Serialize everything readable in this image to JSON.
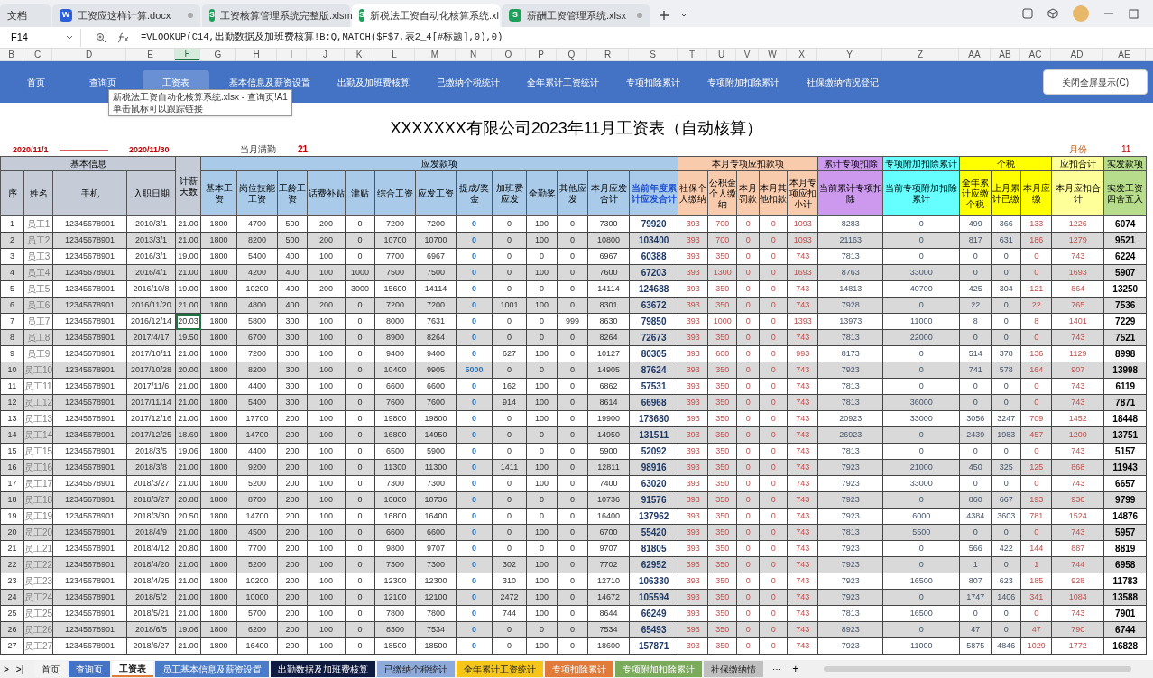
{
  "app_tabs": [
    {
      "kind": "plain",
      "label": "文档",
      "selected": false
    },
    {
      "kind": "doc",
      "icon_letter": "W",
      "label": "工资应这样计算.docx",
      "selected": false
    },
    {
      "kind": "sheet",
      "icon_letter": "S",
      "label": "工资核算管理系统完整版.xlsm",
      "selected": false
    },
    {
      "kind": "sheet",
      "icon_letter": "S",
      "label": "新税法工资自动化核算系统.xl",
      "selected": true
    },
    {
      "kind": "sheet",
      "icon_letter": "S",
      "label": "薪酬工资管理系统.xlsx",
      "selected": false
    }
  ],
  "formula_bar": {
    "cell_ref": "F14",
    "formula": "=VLOOKUP(C14,出勤数据及加班费核算!B:Q,MATCH($F$7,表2_4[#标题],0),0)"
  },
  "column_letters": [
    {
      "label": "B",
      "selected": false
    },
    {
      "label": "C",
      "selected": false
    },
    {
      "label": "D",
      "selected": false
    },
    {
      "label": "E",
      "selected": false
    },
    {
      "label": "F",
      "selected": true
    },
    {
      "label": "G",
      "selected": false
    },
    {
      "label": "H",
      "selected": false
    },
    {
      "label": "I",
      "selected": false
    },
    {
      "label": "J",
      "selected": false
    },
    {
      "label": "K",
      "selected": false
    },
    {
      "label": "L",
      "selected": false
    },
    {
      "label": "M",
      "selected": false
    },
    {
      "label": "N",
      "selected": false
    },
    {
      "label": "O",
      "selected": false
    },
    {
      "label": "P",
      "selected": false
    },
    {
      "label": "Q",
      "selected": false
    },
    {
      "label": "R",
      "selected": false
    },
    {
      "label": "S",
      "selected": false
    },
    {
      "label": "T",
      "selected": false
    },
    {
      "label": "U",
      "selected": false
    },
    {
      "label": "V",
      "selected": false
    },
    {
      "label": "W",
      "selected": false
    },
    {
      "label": "X",
      "selected": false
    },
    {
      "label": "Y",
      "selected": false
    },
    {
      "label": "Z",
      "selected": false
    },
    {
      "label": "AA",
      "selected": false
    },
    {
      "label": "AB",
      "selected": false
    },
    {
      "label": "AC",
      "selected": false
    },
    {
      "label": "AD",
      "selected": false
    },
    {
      "label": "AE",
      "selected": false
    }
  ],
  "nav": {
    "items": [
      {
        "label": "首页",
        "selected": false
      },
      {
        "label": "查询页",
        "selected": false
      },
      {
        "label": "工资表",
        "selected": true
      },
      {
        "label": "基本信息及薪资设置",
        "selected": false
      },
      {
        "label": "出勤及加班费核算",
        "selected": false
      },
      {
        "label": "已缴纳个税统计",
        "selected": false
      },
      {
        "label": "全年累计工资统计",
        "selected": false
      },
      {
        "label": "专项扣除累计",
        "selected": false
      },
      {
        "label": "专项附加扣除累计",
        "selected": false
      },
      {
        "label": "社保缴纳情况登记",
        "selected": false
      }
    ],
    "close_button": "关闭全屏显示(C)"
  },
  "tooltip": {
    "line_1": "新税法工资自动化核算系统.xlsx - 查询页!A1",
    "line_2": "单击鼠标可以跟踪链接"
  },
  "title": "XXXXXXX有限公司2023年11月工资表（自动核算）",
  "period": {
    "start": "2020/11/1",
    "separator": "——————",
    "end": "2020/11/30",
    "full_attendance_label": "当月满勤",
    "full_attendance_days": "21",
    "month_label": "月份",
    "month": "11"
  },
  "header_groups": [
    {
      "label": "基本信息",
      "color": "#c5ccd8",
      "columns": [
        "序",
        "姓名",
        "手机",
        "入职日期"
      ]
    },
    {
      "color": "#c5ccd8",
      "columns": [
        "计薪天数"
      ]
    },
    {
      "label": "应发款项",
      "color": "#a9cbe9",
      "columns": [
        "基本工资",
        "岗位技能工资",
        "工龄工资",
        "话费补贴",
        "津贴",
        "综合工资",
        "应发工资",
        "提成/奖金",
        "加班费应发",
        "全勤奖",
        "其他应发",
        "本月应发合计",
        "当前年度累计应发合计"
      ]
    },
    {
      "label": "本月专项应扣款项",
      "color": "#f8cbad",
      "columns": [
        "社保个人缴纳",
        "公积金个人缴纳",
        "本月罚款",
        "本月其他扣款",
        "本月专项应扣小计"
      ]
    },
    {
      "label": "累计专项扣除",
      "color": "#cc99ee",
      "columns": [
        "当前累计专项扣除"
      ]
    },
    {
      "label": "专项附加扣除累计",
      "color": "#66ffff",
      "columns": [
        "当前专项附加扣除累计"
      ]
    },
    {
      "label": "个税",
      "color": "#ffff00",
      "columns": [
        "全年累计应缴个税",
        "上月累计已缴",
        "本月应缴"
      ]
    },
    {
      "label": "应扣合计",
      "color": "#ffff99",
      "columns": [
        "本月应扣合计"
      ]
    },
    {
      "label": "实发款项",
      "color": "#b7dd8c",
      "columns": [
        "实发工资四舍五入"
      ]
    }
  ],
  "rows": [
    {
      "selected": false,
      "cells": [
        "1",
        "员工1",
        "12345678901",
        "2010/3/1",
        "21.00",
        "1800",
        "4700",
        "500",
        "200",
        "0",
        "7200",
        "7200",
        "0",
        "0",
        "100",
        "0",
        "7300",
        "79920",
        "393",
        "700",
        "0",
        "0",
        "1093",
        "8283",
        "0",
        "499",
        "366",
        "133",
        "1226",
        "6074"
      ]
    },
    {
      "selected": false,
      "cells": [
        "2",
        "员工2",
        "12345678901",
        "2013/3/1",
        "21.00",
        "1800",
        "8200",
        "500",
        "200",
        "0",
        "10700",
        "10700",
        "0",
        "0",
        "100",
        "0",
        "10800",
        "103400",
        "393",
        "700",
        "0",
        "0",
        "1093",
        "21163",
        "0",
        "817",
        "631",
        "186",
        "1279",
        "9521"
      ]
    },
    {
      "selected": false,
      "cells": [
        "3",
        "员工3",
        "12345678901",
        "2016/3/1",
        "19.00",
        "1800",
        "5400",
        "400",
        "100",
        "0",
        "7700",
        "6967",
        "0",
        "0",
        "0",
        "0",
        "6967",
        "60388",
        "393",
        "350",
        "0",
        "0",
        "743",
        "7813",
        "0",
        "0",
        "0",
        "0",
        "743",
        "6224"
      ]
    },
    {
      "selected": false,
      "cells": [
        "4",
        "员工4",
        "12345678901",
        "2016/4/1",
        "21.00",
        "1800",
        "4200",
        "400",
        "100",
        "1000",
        "7500",
        "7500",
        "0",
        "0",
        "100",
        "0",
        "7600",
        "67203",
        "393",
        "1300",
        "0",
        "0",
        "1693",
        "8763",
        "33000",
        "0",
        "0",
        "0",
        "1693",
        "5907"
      ]
    },
    {
      "selected": false,
      "cells": [
        "5",
        "员工5",
        "12345678901",
        "2016/10/8",
        "19.00",
        "1800",
        "10200",
        "400",
        "200",
        "3000",
        "15600",
        "14114",
        "0",
        "0",
        "0",
        "0",
        "14114",
        "124688",
        "393",
        "350",
        "0",
        "0",
        "743",
        "14813",
        "40700",
        "425",
        "304",
        "121",
        "864",
        "13250"
      ]
    },
    {
      "selected": false,
      "cells": [
        "6",
        "员工6",
        "12345678901",
        "2016/11/20",
        "21.00",
        "1800",
        "4800",
        "400",
        "200",
        "0",
        "7200",
        "7200",
        "0",
        "1001",
        "100",
        "0",
        "8301",
        "63672",
        "393",
        "350",
        "0",
        "0",
        "743",
        "7928",
        "0",
        "22",
        "0",
        "22",
        "765",
        "7536"
      ]
    },
    {
      "selected": true,
      "cells": [
        "7",
        "员工7",
        "12345678901",
        "2016/12/14",
        "20.03",
        "1800",
        "5800",
        "300",
        "100",
        "0",
        "8000",
        "7631",
        "0",
        "0",
        "0",
        "999",
        "8630",
        "79850",
        "393",
        "1000",
        "0",
        "0",
        "1393",
        "13973",
        "11000",
        "8",
        "0",
        "8",
        "1401",
        "7229"
      ]
    },
    {
      "selected": false,
      "cells": [
        "8",
        "员工8",
        "12345678901",
        "2017/4/17",
        "19.50",
        "1800",
        "6700",
        "300",
        "100",
        "0",
        "8900",
        "8264",
        "0",
        "0",
        "0",
        "0",
        "8264",
        "72673",
        "393",
        "350",
        "0",
        "0",
        "743",
        "7813",
        "22000",
        "0",
        "0",
        "0",
        "743",
        "7521"
      ]
    },
    {
      "selected": false,
      "cells": [
        "9",
        "员工9",
        "12345678901",
        "2017/10/11",
        "21.00",
        "1800",
        "7200",
        "300",
        "100",
        "0",
        "9400",
        "9400",
        "0",
        "627",
        "100",
        "0",
        "10127",
        "80305",
        "393",
        "600",
        "0",
        "0",
        "993",
        "8173",
        "0",
        "514",
        "378",
        "136",
        "1129",
        "8998"
      ]
    },
    {
      "selected": false,
      "cells": [
        "10",
        "员工10",
        "12345678901",
        "2017/10/28",
        "20.00",
        "1800",
        "8200",
        "300",
        "100",
        "0",
        "10400",
        "9905",
        "5000",
        "0",
        "0",
        "0",
        "14905",
        "87624",
        "393",
        "350",
        "0",
        "0",
        "743",
        "7923",
        "0",
        "741",
        "578",
        "164",
        "907",
        "13998"
      ]
    },
    {
      "selected": false,
      "cells": [
        "11",
        "员工11",
        "12345678901",
        "2017/11/6",
        "21.00",
        "1800",
        "4400",
        "300",
        "100",
        "0",
        "6600",
        "6600",
        "0",
        "162",
        "100",
        "0",
        "6862",
        "57531",
        "393",
        "350",
        "0",
        "0",
        "743",
        "7813",
        "0",
        "0",
        "0",
        "0",
        "743",
        "6119"
      ]
    },
    {
      "selected": false,
      "cells": [
        "12",
        "员工12",
        "12345678901",
        "2017/11/14",
        "21.00",
        "1800",
        "5400",
        "300",
        "100",
        "0",
        "7600",
        "7600",
        "0",
        "914",
        "100",
        "0",
        "8614",
        "66968",
        "393",
        "350",
        "0",
        "0",
        "743",
        "7813",
        "36000",
        "0",
        "0",
        "0",
        "743",
        "7871"
      ]
    },
    {
      "selected": false,
      "cells": [
        "13",
        "员工13",
        "12345678901",
        "2017/12/16",
        "21.00",
        "1800",
        "17700",
        "200",
        "100",
        "0",
        "19800",
        "19800",
        "0",
        "0",
        "100",
        "0",
        "19900",
        "173680",
        "393",
        "350",
        "0",
        "0",
        "743",
        "20923",
        "33000",
        "3056",
        "3247",
        "709",
        "1452",
        "18448"
      ]
    },
    {
      "selected": false,
      "cells": [
        "14",
        "员工14",
        "12345678901",
        "2017/12/25",
        "18.69",
        "1800",
        "14700",
        "200",
        "100",
        "0",
        "16800",
        "14950",
        "0",
        "0",
        "0",
        "0",
        "14950",
        "131511",
        "393",
        "350",
        "0",
        "0",
        "743",
        "26923",
        "0",
        "2439",
        "1983",
        "457",
        "1200",
        "13751"
      ]
    },
    {
      "selected": false,
      "cells": [
        "15",
        "员工15",
        "12345678901",
        "2018/3/5",
        "19.06",
        "1800",
        "4400",
        "200",
        "100",
        "0",
        "6500",
        "5900",
        "0",
        "0",
        "0",
        "0",
        "5900",
        "52092",
        "393",
        "350",
        "0",
        "0",
        "743",
        "7813",
        "0",
        "0",
        "0",
        "0",
        "743",
        "5157"
      ]
    },
    {
      "selected": false,
      "cells": [
        "16",
        "员工16",
        "12345678901",
        "2018/3/8",
        "21.00",
        "1800",
        "9200",
        "200",
        "100",
        "0",
        "11300",
        "11300",
        "0",
        "1411",
        "100",
        "0",
        "12811",
        "98916",
        "393",
        "350",
        "0",
        "0",
        "743",
        "7923",
        "21000",
        "450",
        "325",
        "125",
        "868",
        "11943"
      ]
    },
    {
      "selected": false,
      "cells": [
        "17",
        "员工17",
        "12345678901",
        "2018/3/27",
        "21.00",
        "1800",
        "5200",
        "200",
        "100",
        "0",
        "7300",
        "7300",
        "0",
        "0",
        "100",
        "0",
        "7400",
        "63020",
        "393",
        "350",
        "0",
        "0",
        "743",
        "7923",
        "33000",
        "0",
        "0",
        "0",
        "743",
        "6657"
      ]
    },
    {
      "selected": false,
      "cells": [
        "18",
        "员工18",
        "12345678901",
        "2018/3/27",
        "20.88",
        "1800",
        "8700",
        "200",
        "100",
        "0",
        "10800",
        "10736",
        "0",
        "0",
        "0",
        "0",
        "10736",
        "91576",
        "393",
        "350",
        "0",
        "0",
        "743",
        "7923",
        "0",
        "860",
        "667",
        "193",
        "936",
        "9799"
      ]
    },
    {
      "selected": false,
      "cells": [
        "19",
        "员工19",
        "12345678901",
        "2018/3/30",
        "20.50",
        "1800",
        "14700",
        "200",
        "100",
        "0",
        "16800",
        "16400",
        "0",
        "0",
        "0",
        "0",
        "16400",
        "137962",
        "393",
        "350",
        "0",
        "0",
        "743",
        "7923",
        "6000",
        "4384",
        "3603",
        "781",
        "1524",
        "14876"
      ]
    },
    {
      "selected": false,
      "cells": [
        "20",
        "员工20",
        "12345678901",
        "2018/4/9",
        "21.00",
        "1800",
        "4500",
        "200",
        "100",
        "0",
        "6600",
        "6600",
        "0",
        "0",
        "100",
        "0",
        "6700",
        "55420",
        "393",
        "350",
        "0",
        "0",
        "743",
        "7813",
        "5500",
        "0",
        "0",
        "0",
        "743",
        "5957"
      ]
    },
    {
      "selected": false,
      "cells": [
        "21",
        "员工21",
        "12345678901",
        "2018/4/12",
        "20.80",
        "1800",
        "7700",
        "200",
        "100",
        "0",
        "9800",
        "9707",
        "0",
        "0",
        "0",
        "0",
        "9707",
        "81805",
        "393",
        "350",
        "0",
        "0",
        "743",
        "7923",
        "0",
        "566",
        "422",
        "144",
        "887",
        "8819"
      ]
    },
    {
      "selected": false,
      "cells": [
        "22",
        "员工22",
        "12345678901",
        "2018/4/20",
        "21.00",
        "1800",
        "5200",
        "200",
        "100",
        "0",
        "7300",
        "7300",
        "0",
        "302",
        "100",
        "0",
        "7702",
        "62952",
        "393",
        "350",
        "0",
        "0",
        "743",
        "7923",
        "0",
        "1",
        "0",
        "1",
        "744",
        "6958"
      ]
    },
    {
      "selected": false,
      "cells": [
        "23",
        "员工23",
        "12345678901",
        "2018/4/25",
        "21.00",
        "1800",
        "10200",
        "200",
        "100",
        "0",
        "12300",
        "12300",
        "0",
        "310",
        "100",
        "0",
        "12710",
        "106330",
        "393",
        "350",
        "0",
        "0",
        "743",
        "7923",
        "16500",
        "807",
        "623",
        "185",
        "928",
        "11783"
      ]
    },
    {
      "selected": false,
      "cells": [
        "24",
        "员工24",
        "12345678901",
        "2018/5/2",
        "21.00",
        "1800",
        "10000",
        "200",
        "100",
        "0",
        "12100",
        "12100",
        "0",
        "2472",
        "100",
        "0",
        "14672",
        "105594",
        "393",
        "350",
        "0",
        "0",
        "743",
        "7923",
        "0",
        "1747",
        "1406",
        "341",
        "1084",
        "13588"
      ]
    },
    {
      "selected": false,
      "cells": [
        "25",
        "员工25",
        "12345678901",
        "2018/5/21",
        "21.00",
        "1800",
        "5700",
        "200",
        "100",
        "0",
        "7800",
        "7800",
        "0",
        "744",
        "100",
        "0",
        "8644",
        "66249",
        "393",
        "350",
        "0",
        "0",
        "743",
        "7813",
        "16500",
        "0",
        "0",
        "0",
        "743",
        "7901"
      ]
    },
    {
      "selected": false,
      "cells": [
        "26",
        "员工26",
        "12345678901",
        "2018/6/5",
        "19.06",
        "1800",
        "6200",
        "200",
        "100",
        "0",
        "8300",
        "7534",
        "0",
        "0",
        "0",
        "0",
        "7534",
        "65493",
        "393",
        "350",
        "0",
        "0",
        "743",
        "8923",
        "0",
        "47",
        "0",
        "47",
        "790",
        "6744"
      ]
    },
    {
      "selected": false,
      "cells": [
        "27",
        "员工27",
        "12345678901",
        "2018/6/27",
        "21.00",
        "1800",
        "16400",
        "200",
        "100",
        "0",
        "18500",
        "18500",
        "0",
        "0",
        "100",
        "0",
        "18600",
        "157871",
        "393",
        "350",
        "0",
        "0",
        "743",
        "7923",
        "11000",
        "5875",
        "4846",
        "1029",
        "1772",
        "16828"
      ]
    }
  ],
  "sheet_tabs": [
    {
      "label": "首页",
      "color": "#f3f3f3",
      "selected": false
    },
    {
      "label": "查询页",
      "color": "#4472c4",
      "selected": false
    },
    {
      "label": "工资表",
      "color": "#ffffff",
      "selected": true
    },
    {
      "label": "员工基本信息及薪资设置",
      "color": "#4a7cc9",
      "selected": false
    },
    {
      "label": "出勤数据及加班费核算",
      "color": "#0f1a40",
      "selected": false
    },
    {
      "label": "已缴纳个税统计",
      "color": "#8eaadb",
      "selected": false
    },
    {
      "label": "全年累计工资统计",
      "color": "#f5c518",
      "selected": false
    },
    {
      "label": "专项扣除累计",
      "color": "#e07b39",
      "selected": false
    },
    {
      "label": "专项附加扣除累计",
      "color": "#7aab5a",
      "selected": false
    },
    {
      "label": "社保缴纳情",
      "color": "#bfbfbf",
      "selected": false
    }
  ],
  "sheet_tab_controls": {
    "first": ">",
    "last": ">|",
    "more": "⋯",
    "add": "+"
  }
}
